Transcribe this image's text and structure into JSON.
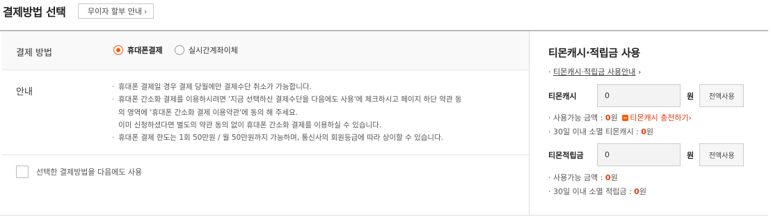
{
  "header": {
    "title": "결제방법 선택",
    "installment_btn": "무이자 할부 안내"
  },
  "method": {
    "label": "결제 방법",
    "options": [
      {
        "label": "휴대폰결제",
        "selected": true
      },
      {
        "label": "실시간계좌이체",
        "selected": false
      }
    ]
  },
  "info": {
    "label": "안내",
    "notes": [
      "휴대폰 결제일 경우 결제 당월에만 결제수단 취소가 가능합니다.",
      "휴대폰 간소화 결제를 이용하시려면 '지금 선택하신 결제수단을 다음에도 사용'에 체크하시고 페이지 하단 약관 동",
      "의 영역에 '휴대폰 간소화 결제 이용약관'에 동의 해 주세요.",
      "이미 신청하셨다면 별도의 약관 동의 없이 휴대폰 간소화 결제를 이용하실 수 있습니다.",
      "휴대폰 결제 한도는 1회 50만원 / 월 50만원까지 가능하며, 통신사의 회원등급에 따라 상이할 수 있습니다."
    ]
  },
  "remember": {
    "label": "선택한 결제방법을 다음에도 사용",
    "checked": false
  },
  "points": {
    "title": "티몬캐시·적립금 사용",
    "guide_link": "티몬캐시·적립금 사용안내",
    "cash": {
      "label": "티몬캐시",
      "value": "0",
      "unit": "원",
      "use_all": "전액사용",
      "avail_prefix": "사용가능 금액 : ",
      "avail_value": "0",
      "avail_unit": "원",
      "charge_link": "티몬캐시 충전하기",
      "expire_prefix": "30일 이내 소멸 티몬캐시 : ",
      "expire_value": "0",
      "expire_unit": "원"
    },
    "reserve": {
      "label": "티몬적립금",
      "value": "0",
      "unit": "원",
      "use_all": "전액사용",
      "avail_prefix": "사용가능 금액 : ",
      "avail_value": "0",
      "avail_unit": "원",
      "expire_prefix": "30일 이내 소멸 적립금 : ",
      "expire_value": "0",
      "expire_unit": "원"
    }
  },
  "colors": {
    "accent": "#ff5a00",
    "highlight": "#e8380d"
  }
}
